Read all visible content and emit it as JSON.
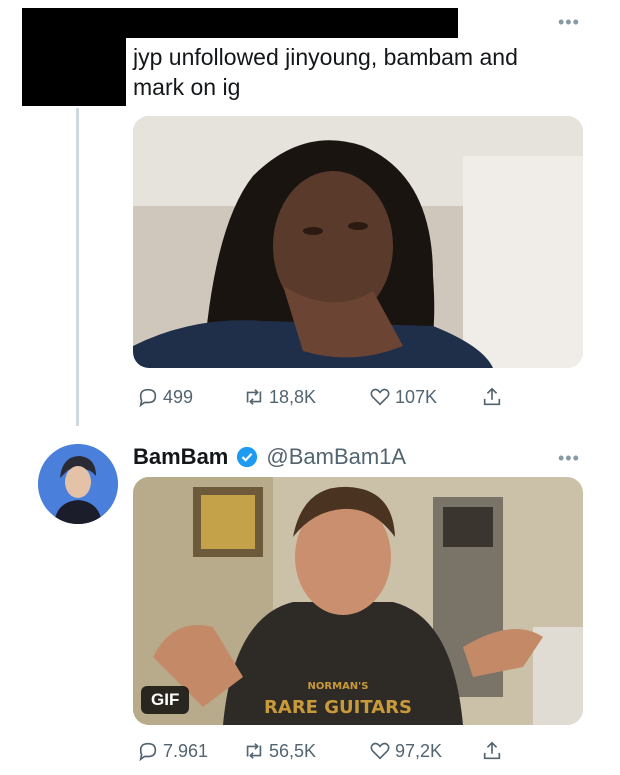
{
  "tweet1": {
    "text": "jyp unfollowed jinyoung, bambam and mark on ig",
    "stats": {
      "replies": "499",
      "retweets": "18,8K",
      "likes": "107K"
    }
  },
  "tweet2": {
    "author_name": "BamBam",
    "author_handle": "@BamBam1A",
    "media_badge": "GIF",
    "stats": {
      "replies": "7.961",
      "retweets": "56,5K",
      "likes": "97,2K"
    },
    "shirt_text_line1": "NORMAN'S",
    "shirt_text_line2": "RARE GUITARS"
  },
  "colors": {
    "verified": "#1d9bf0",
    "action_gray": "#536471",
    "thread_line": "#cfd9de"
  },
  "icons": [
    "more-icon",
    "reply-icon",
    "retweet-icon",
    "like-icon",
    "share-icon",
    "verified-icon"
  ]
}
